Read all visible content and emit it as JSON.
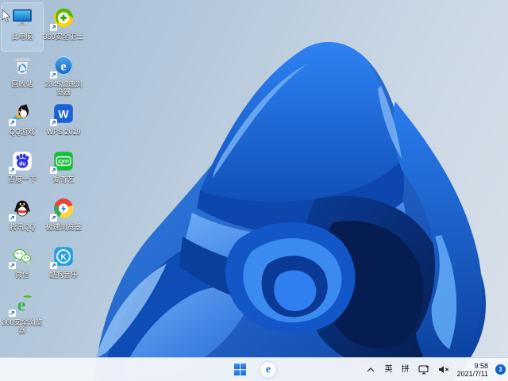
{
  "desktop": {
    "icons": [
      {
        "label": "此电脑",
        "selected": true,
        "shortcut": false
      },
      {
        "label": "360安全卫士",
        "selected": false,
        "shortcut": true
      },
      {
        "label": "回收站",
        "selected": false,
        "shortcut": false
      },
      {
        "label": "2345加速浏览器",
        "selected": false,
        "shortcut": true
      },
      {
        "label": "QQ游戏",
        "selected": false,
        "shortcut": true
      },
      {
        "label": "WPS 2019",
        "selected": false,
        "shortcut": true
      },
      {
        "label": "百度一下",
        "selected": false,
        "shortcut": true
      },
      {
        "label": "爱奇艺",
        "selected": false,
        "shortcut": true
      },
      {
        "label": "腾讯QQ",
        "selected": false,
        "shortcut": true
      },
      {
        "label": "极速浏览器",
        "selected": false,
        "shortcut": true
      },
      {
        "label": "微信",
        "selected": false,
        "shortcut": true
      },
      {
        "label": "酷狗音乐",
        "selected": false,
        "shortcut": true
      },
      {
        "label": "360安全浏览器",
        "selected": false,
        "shortcut": true
      }
    ],
    "icon_glyphs": {
      "e_2345": "e",
      "wps": "W",
      "baidu": "du",
      "iqiyi": "iQIYI",
      "kugou": "K",
      "e_green": "e",
      "taskbar_e": "e"
    }
  },
  "taskbar": {
    "tray": {
      "ime_english": "英",
      "ime_pinyin": "拼",
      "time": "9:58",
      "date": "2021/7/11",
      "notification_count": "3"
    }
  },
  "colors": {
    "taskbar_bg": "#f3f6fa",
    "badge_blue": "#0b63c5",
    "selection_highlight": "#bcd4ea",
    "bloom_mid_blue": "#1d6ae0",
    "bloom_dark_navy": "#082a66",
    "background_top_left": "#a6bdd3",
    "background_bottom_right": "#dbe3ec"
  }
}
